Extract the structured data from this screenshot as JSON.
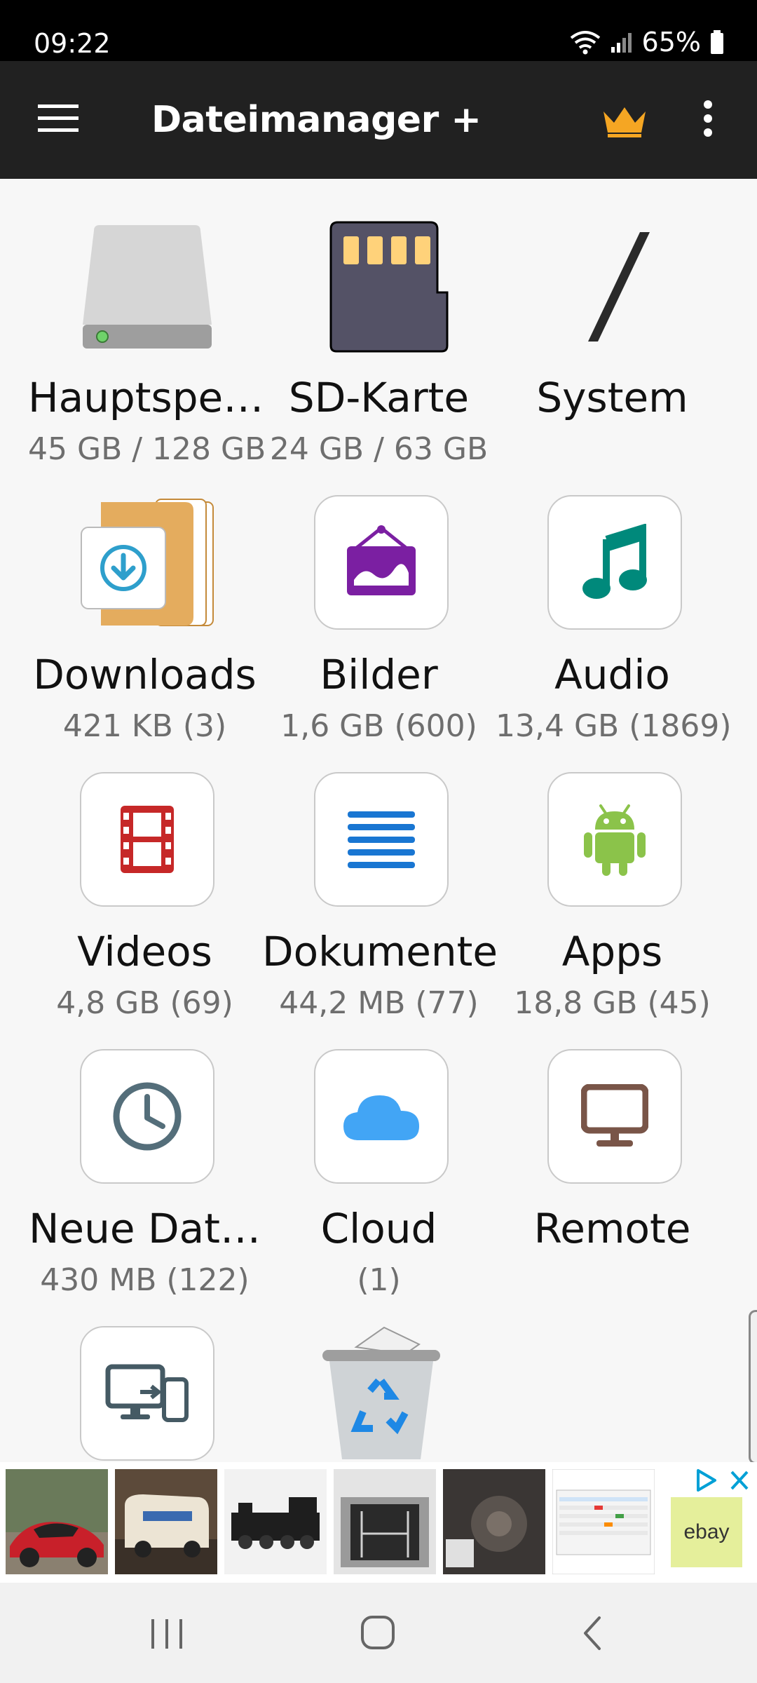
{
  "status_bar": {
    "time": "09:22",
    "battery": "65%"
  },
  "app_bar": {
    "title": "Dateimanager +"
  },
  "tiles": [
    {
      "name": "Hauptspe…",
      "sub": "45 GB / 128 GB",
      "icon": "internal-storage-icon"
    },
    {
      "name": "SD-Karte",
      "sub": "24 GB / 63 GB",
      "icon": "sd-card-icon"
    },
    {
      "name": "System",
      "sub": "",
      "icon": "root-slash-icon"
    },
    {
      "name": "Downloads",
      "sub": "421 KB (3)",
      "icon": "downloads-folder-icon"
    },
    {
      "name": "Bilder",
      "sub": "1,6 GB (600)",
      "icon": "image-icon"
    },
    {
      "name": "Audio",
      "sub": "13,4 GB (1869)",
      "icon": "music-note-icon"
    },
    {
      "name": "Videos",
      "sub": "4,8 GB (69)",
      "icon": "film-icon"
    },
    {
      "name": "Dokumente",
      "sub": "44,2 MB (77)",
      "icon": "document-lines-icon"
    },
    {
      "name": "Apps",
      "sub": "18,8 GB (45)",
      "icon": "android-icon"
    },
    {
      "name": "Neue Dat…",
      "sub": "430 MB (122)",
      "icon": "clock-icon"
    },
    {
      "name": "Cloud",
      "sub": "(1)",
      "icon": "cloud-icon"
    },
    {
      "name": "Remote",
      "sub": "",
      "icon": "monitor-icon"
    },
    {
      "name": "",
      "sub": "",
      "icon": "device-transfer-icon"
    },
    {
      "name": "",
      "sub": "",
      "icon": "recycle-bin-icon"
    }
  ],
  "ad": {
    "ebay_label": "ebay"
  },
  "colors": {
    "app_bar": "#212121",
    "crown": "#f5a623",
    "image_purple": "#7b1fa2",
    "music_teal": "#00897b",
    "film_red": "#c62828",
    "doc_blue": "#1976d2",
    "android_green": "#8bc34a",
    "clock_slate": "#546e7a",
    "cloud_blue": "#42a5f5",
    "monitor_brown": "#795548",
    "transfer_gray": "#455a64"
  }
}
